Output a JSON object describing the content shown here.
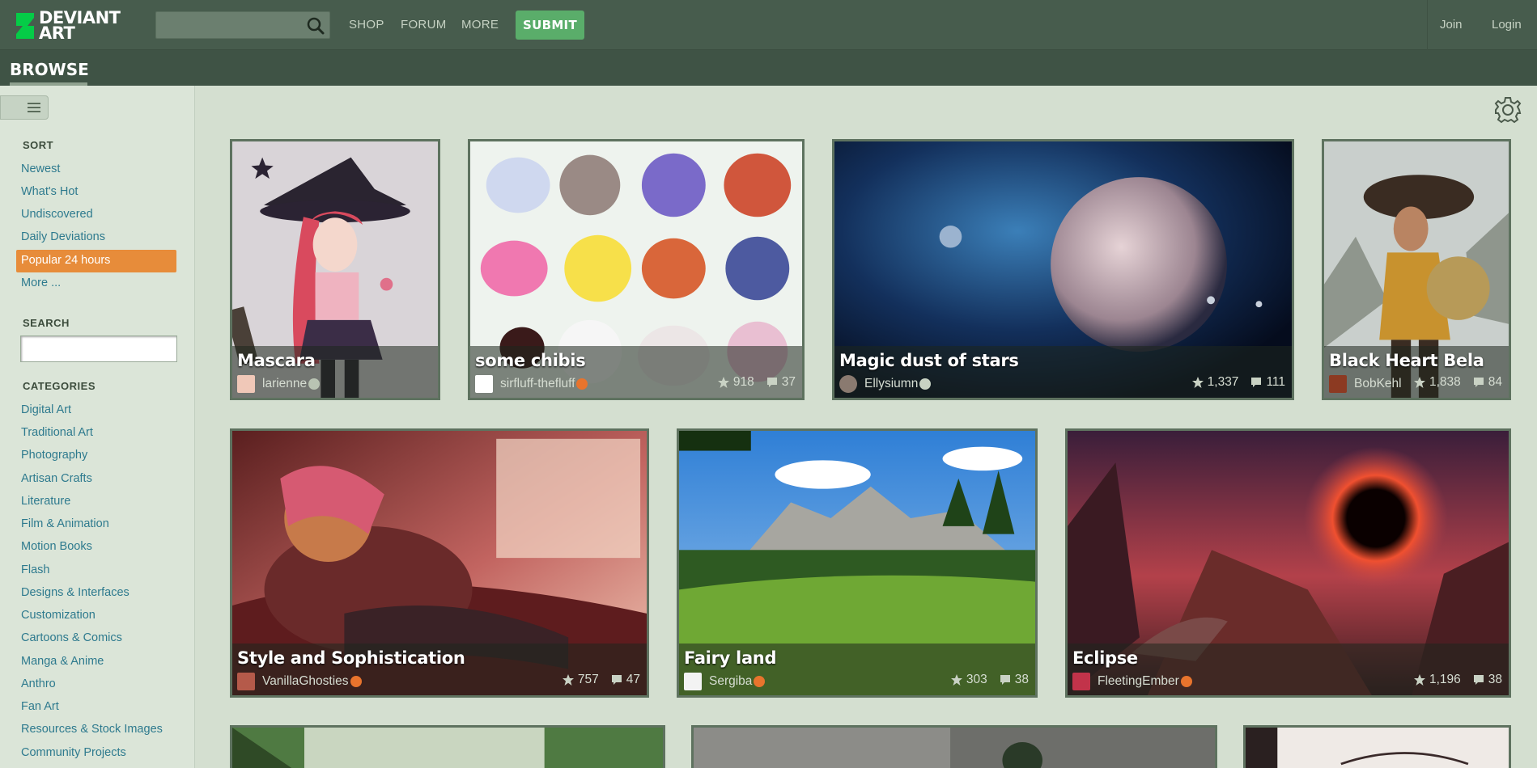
{
  "header": {
    "logo_line1": "DEVIANT",
    "logo_line2": "ART",
    "search_placeholder": "",
    "nav": [
      "SHOP",
      "FORUM",
      "MORE"
    ],
    "submit_label": "SUBMIT",
    "join_label": "Join",
    "login_label": "Login"
  },
  "browse": {
    "title": "BROWSE"
  },
  "sidebar": {
    "sort_heading": "SORT",
    "sort_items": [
      "Newest",
      "What's Hot",
      "Undiscovered",
      "Daily Deviations",
      "Popular 24 hours",
      "More ..."
    ],
    "search_heading": "SEARCH",
    "search_value": "",
    "categories_heading": "CATEGORIES",
    "categories": [
      "Digital Art",
      "Traditional Art",
      "Photography",
      "Artisan Crafts",
      "Literature",
      "Film & Animation",
      "Motion Books",
      "Flash",
      "Designs & Interfaces",
      "Customization",
      "Cartoons & Comics",
      "Manga & Anime",
      "Anthro",
      "Fan Art",
      "Resources & Stock Images",
      "Community Projects"
    ]
  },
  "gallery": {
    "settings_icon": "gear-icon",
    "items": [
      {
        "title": "Mascara",
        "author": "larienne",
        "favs": "",
        "comments": "",
        "badge_icon": "award-icon"
      },
      {
        "title": "some chibis",
        "author": "sirfluff-thefluff",
        "favs": "918",
        "comments": "37",
        "badge_icon": "core-member-icon"
      },
      {
        "title": "Magic dust of stars",
        "author": "Ellysiumn",
        "favs": "1,337",
        "comments": "111",
        "badge_icon": "heart-icon"
      },
      {
        "title": "Black Heart Bela",
        "author": "BobKehl",
        "favs": "1,838",
        "comments": "84",
        "badge_icon": ""
      },
      {
        "title": "Style and Sophistication",
        "author": "VanillaGhosties",
        "favs": "757",
        "comments": "47",
        "badge_icon": "core-member-icon"
      },
      {
        "title": "Fairy land",
        "author": "Sergiba",
        "favs": "303",
        "comments": "38",
        "badge_icon": "core-member-icon"
      },
      {
        "title": "Eclipse",
        "author": "FleetingEmber",
        "favs": "1,196",
        "comments": "38",
        "badge_icon": "core-member-icon"
      }
    ]
  },
  "colors": {
    "topbar": "#475c4d",
    "accent_orange": "#e78c3a",
    "submit_green": "#5aad6a",
    "link": "#2e7a8e",
    "background": "#d4dfd0"
  }
}
